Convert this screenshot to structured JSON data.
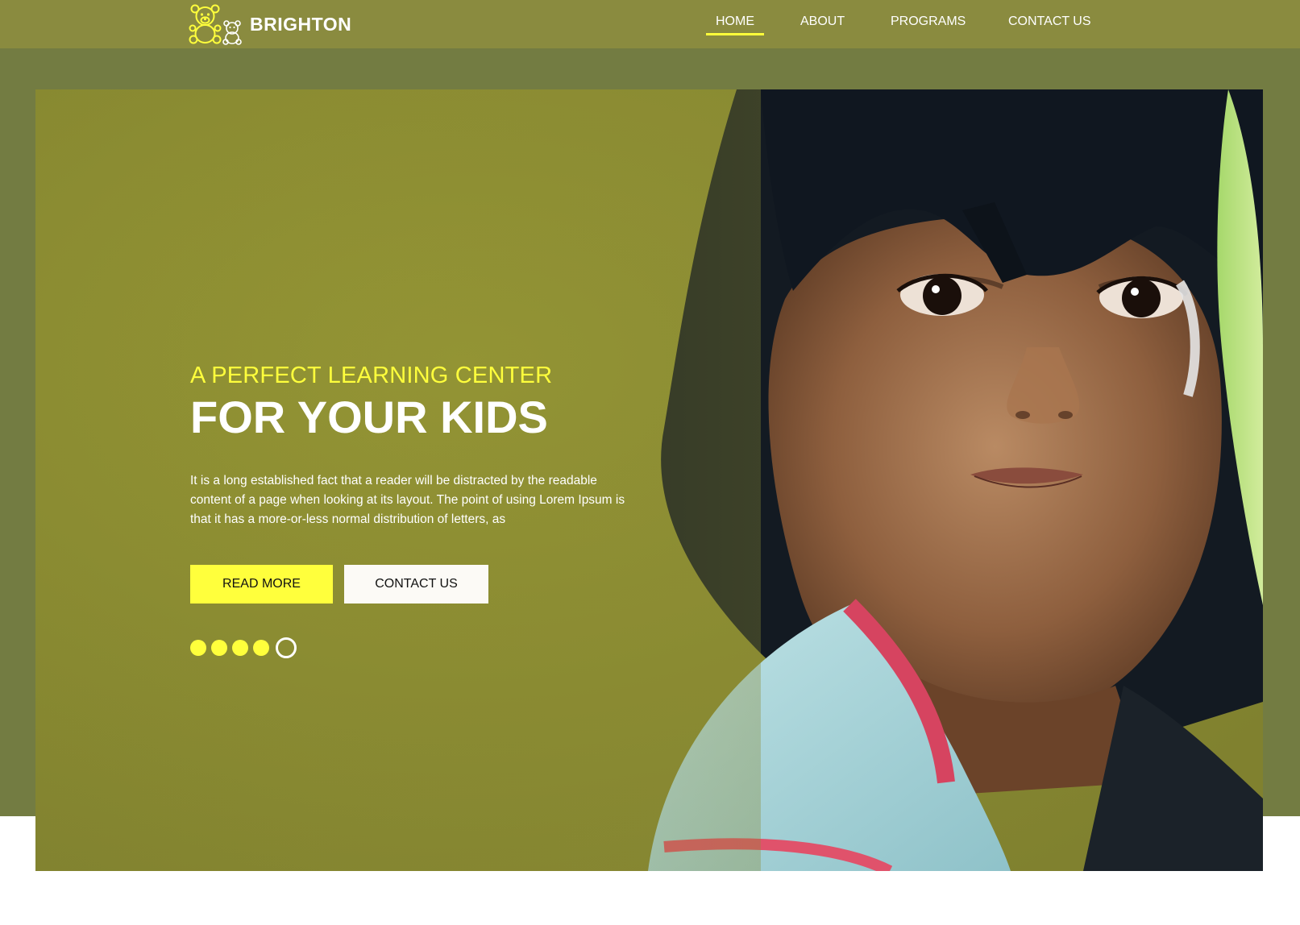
{
  "brand": {
    "name": "BRIGHTON",
    "accent_color": "#ffff3c"
  },
  "nav": {
    "items": [
      {
        "label": "HOME",
        "active": true
      },
      {
        "label": "ABOUT",
        "active": false
      },
      {
        "label": "PROGRAMS",
        "active": false
      },
      {
        "label": "CONTACT US",
        "active": false
      }
    ]
  },
  "colors": {
    "topbar": "#8a8b3f",
    "band": "#737c42",
    "accent": "#ffff3c"
  },
  "hero": {
    "kicker": "A PERFECT LEARNING CENTER",
    "headline": "FOR YOUR KIDS",
    "body": "It is a long established fact that a reader will be distracted by the readable content of a page when looking at its layout. The point of using Lorem Ipsum is that it has a more-or-less normal distribution of letters, as",
    "primary_button": "READ MORE",
    "secondary_button": "CONTACT US",
    "image": "child-portrait-photo",
    "slider": {
      "total": 5,
      "current": 5
    }
  }
}
